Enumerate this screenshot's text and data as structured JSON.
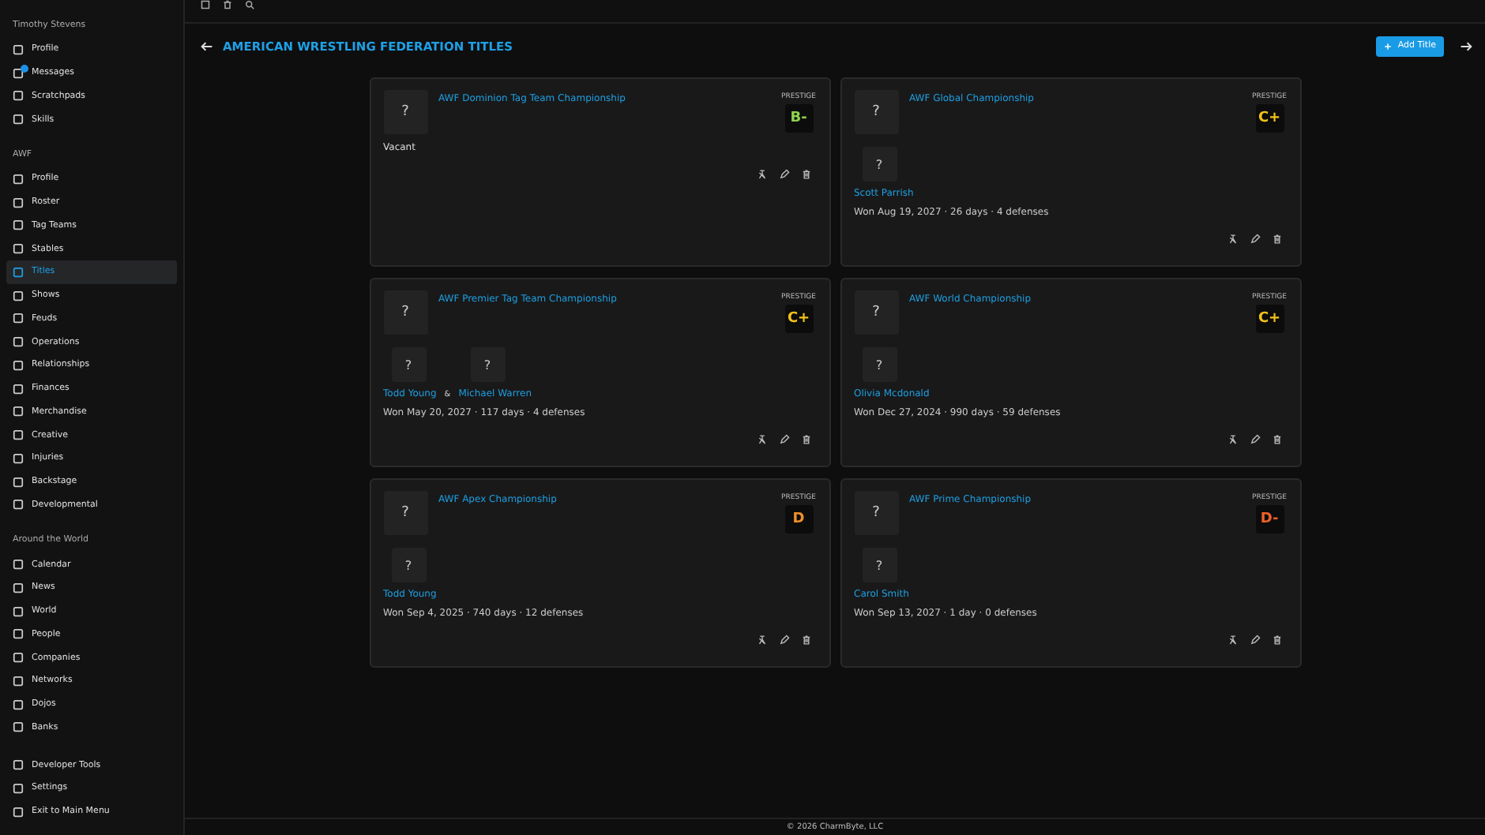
{
  "sidebar": {
    "sections": [
      {
        "heading": "Timothy Stevens",
        "items": [
          {
            "label": "Profile",
            "selected": false,
            "notification": false
          },
          {
            "label": "Messages",
            "selected": false,
            "notification": true
          },
          {
            "label": "Scratchpads",
            "selected": false,
            "notification": false
          },
          {
            "label": "Skills",
            "selected": false,
            "notification": false
          }
        ]
      },
      {
        "heading": "AWF",
        "items": [
          {
            "label": "Profile",
            "selected": false,
            "notification": false
          },
          {
            "label": "Roster",
            "selected": false,
            "notification": false
          },
          {
            "label": "Tag Teams",
            "selected": false,
            "notification": false
          },
          {
            "label": "Stables",
            "selected": false,
            "notification": false
          },
          {
            "label": "Titles",
            "selected": true,
            "notification": false
          },
          {
            "label": "Shows",
            "selected": false,
            "notification": false
          },
          {
            "label": "Feuds",
            "selected": false,
            "notification": false
          },
          {
            "label": "Operations",
            "selected": false,
            "notification": false
          },
          {
            "label": "Relationships",
            "selected": false,
            "notification": false
          },
          {
            "label": "Finances",
            "selected": false,
            "notification": false
          },
          {
            "label": "Merchandise",
            "selected": false,
            "notification": false
          },
          {
            "label": "Creative",
            "selected": false,
            "notification": false
          },
          {
            "label": "Injuries",
            "selected": false,
            "notification": false
          },
          {
            "label": "Backstage",
            "selected": false,
            "notification": false
          },
          {
            "label": "Developmental",
            "selected": false,
            "notification": false
          }
        ]
      },
      {
        "heading": "Around the World",
        "items": [
          {
            "label": "Calendar",
            "selected": false,
            "notification": false
          },
          {
            "label": "News",
            "selected": false,
            "notification": false
          },
          {
            "label": "World",
            "selected": false,
            "notification": false
          },
          {
            "label": "People",
            "selected": false,
            "notification": false
          },
          {
            "label": "Companies",
            "selected": false,
            "notification": false
          },
          {
            "label": "Networks",
            "selected": false,
            "notification": false
          },
          {
            "label": "Dojos",
            "selected": false,
            "notification": false
          },
          {
            "label": "Banks",
            "selected": false,
            "notification": false
          }
        ]
      },
      {
        "items": [
          {
            "label": "Developer Tools",
            "selected": false,
            "notification": false
          },
          {
            "label": "Settings",
            "selected": false,
            "notification": false
          },
          {
            "label": "Exit to Main Menu",
            "selected": false,
            "notification": false
          }
        ]
      }
    ]
  },
  "page": {
    "title": "AMERICAN WRESTLING FEDERATION TITLES",
    "add_button": "Add Title"
  },
  "titles": [
    {
      "name": "AWF Dominion Tag Team Championship",
      "belt_image": "?",
      "prestige_label": "PRESTIGE",
      "grade": "B-",
      "color": "#8fd14f",
      "status": "Vacant"
    },
    {
      "name": "AWF Global Championship",
      "belt_image": "?",
      "prestige_label": "PRESTIGE",
      "grade": "C+",
      "color": "#f2c318",
      "holders": [
        {
          "image": "?",
          "name": "Scott Parrish"
        }
      ],
      "reign": "Won Aug 19, 2027 · 26 days · 4 defenses"
    },
    {
      "name": "AWF Premier Tag Team Championship",
      "belt_image": "?",
      "prestige_label": "PRESTIGE",
      "grade": "C+",
      "color": "#f2c318",
      "holders": [
        {
          "image": "?",
          "name": "Todd Young"
        },
        {
          "image": "?",
          "name": "Michael Warren"
        }
      ],
      "joiner": "&",
      "reign": "Won May 20, 2027 · 117 days · 4 defenses"
    },
    {
      "name": "AWF World Championship",
      "belt_image": "?",
      "prestige_label": "PRESTIGE",
      "grade": "C+",
      "color": "#f2c318",
      "holders": [
        {
          "image": "?",
          "name": "Olivia Mcdonald"
        }
      ],
      "reign": "Won Dec 27, 2024 · 990 days · 59 defenses"
    },
    {
      "name": "AWF Apex Championship",
      "belt_image": "?",
      "prestige_label": "PRESTIGE",
      "grade": "D",
      "color": "#f0902a",
      "holders": [
        {
          "image": "?",
          "name": "Todd Young"
        }
      ],
      "reign": "Won Sep 4, 2025 · 740 days · 12 defenses"
    },
    {
      "name": "AWF Prime Championship",
      "belt_image": "?",
      "prestige_label": "PRESTIGE",
      "grade": "D-",
      "color": "#f0602a",
      "holders": [
        {
          "image": "?",
          "name": "Carol Smith"
        }
      ],
      "reign": "Won Sep 13, 2027 · 1 day · 0 defenses"
    }
  ],
  "footer": "© 2026 CharmByte, LLC"
}
